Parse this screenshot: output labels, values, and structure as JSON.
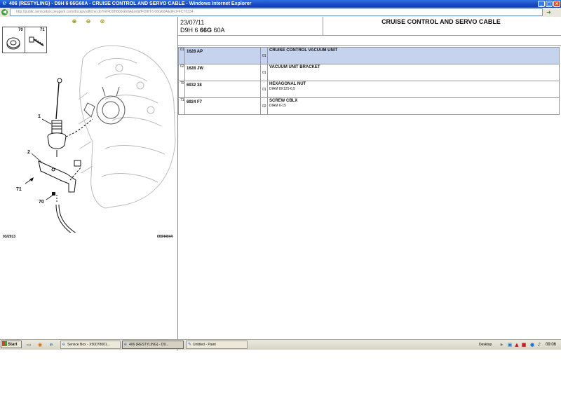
{
  "window": {
    "title": "406 (RESTYLING) - D9H 6 66G60A - CRUISE CONTROL AND SERVO CABLE - Windows Internet Explorer",
    "url": "http://public.servicebox.peugeot.com/docapv/affiche.do?ref=D9H666G60A&refaff=D9H 6 66G60A&dFct=FCT0334"
  },
  "diagram": {
    "legend": [
      {
        "code": "70",
        "icon": "hexagonal-nut-icon"
      },
      {
        "code": "71",
        "icon": "screw-icon"
      }
    ],
    "callouts": [
      "1",
      "2",
      "71",
      "70"
    ],
    "date": "03/2013",
    "ref": "00044044"
  },
  "header": {
    "date": "23/07/11",
    "engine_prefix": "D9H 6 ",
    "engine_bold": "66G",
    "engine_suffix": " 60A",
    "title": "CRUISE CONTROL AND SERVO CABLE"
  },
  "parts": [
    {
      "line": "01",
      "part_no": "1628 AP",
      "qty": "01",
      "desc": "CRUISE CONTROL VACUUM UNIT",
      "sub": "",
      "selected": true
    },
    {
      "line": "02",
      "part_no": "1628 JW",
      "qty": "01",
      "desc": "VACUUM UNIT BRACKET",
      "sub": "",
      "selected": false
    },
    {
      "line": "70",
      "part_no": "6932 38",
      "qty": "01",
      "desc": "HEXAGONAL NUT",
      "sub": "DIAM 8X125-6,5",
      "selected": false
    },
    {
      "line": "71",
      "part_no": "6924 F7",
      "qty": "02",
      "desc": "SCREW CBLX",
      "sub": "DIAM 6-15",
      "selected": false
    }
  ],
  "taskbar": {
    "start_label": "Start",
    "tasks": [
      {
        "label": "Service Box - X50078001...",
        "active": false
      },
      {
        "label": "406 (RESTYLING) - D9...",
        "active": true
      },
      {
        "label": "Untitled - Paint",
        "active": false
      }
    ],
    "desktop_label": "Desktop",
    "clock": "09:06"
  }
}
